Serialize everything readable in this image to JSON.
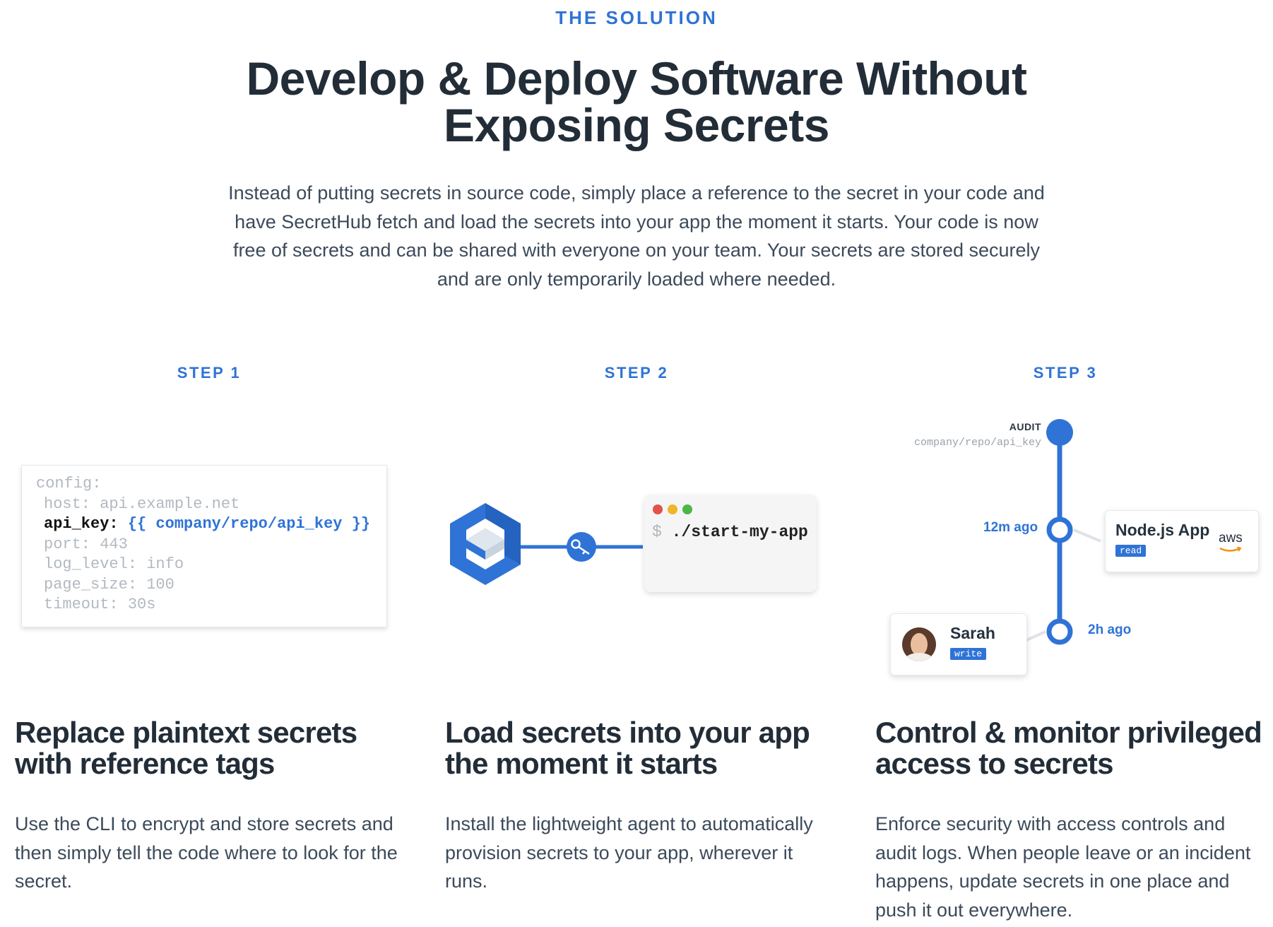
{
  "section": {
    "eyebrow": "THE SOLUTION",
    "headline_line1": "Develop & Deploy Software Without",
    "headline_line2": "Exposing Secrets",
    "intro": "Instead of putting secrets in source code, simply place a reference to the secret in your code and have SecretHub fetch and load the secrets into your app the moment it starts. Your code is now free of secrets and can be shared with everyone on your team. Your secrets are stored securely and are only temporarily loaded where needed."
  },
  "steps": [
    {
      "label": "STEP 1",
      "title": "Replace plaintext secrets with reference tags",
      "description": "Use the CLI to encrypt and store secrets and then simply tell the code where to look for the secret."
    },
    {
      "label": "STEP 2",
      "title": "Load secrets into your app the moment it starts",
      "description": "Install the lightweight agent to automatically provision secrets to your app, wherever it runs."
    },
    {
      "label": "STEP 3",
      "title": "Control & monitor privileged access to secrets",
      "description": "Enforce security with access controls and audit logs. When people leave or an incident happens, update secrets in one place and push it out everywhere."
    }
  ],
  "code_sample": {
    "line1": "config:",
    "line2": "host: api.example.net",
    "line3_key": "api_key:",
    "line3_value": "{{ company/repo/api_key }}",
    "line4": "port: 443",
    "line5": "log_level: info",
    "line6": "page_size: 100",
    "line7": "timeout: 30s"
  },
  "terminal": {
    "prompt": "$",
    "command": "./start-my-app",
    "dot_colors": [
      "#e0524b",
      "#f0b429",
      "#4bb748"
    ]
  },
  "audit": {
    "label": "AUDIT",
    "path": "company/repo/api_key",
    "event1": {
      "time": "12m ago",
      "actor": "Node.js App",
      "permission": "read",
      "provider": "aws"
    },
    "event2": {
      "time": "2h ago",
      "actor": "Sarah",
      "permission": "write"
    }
  },
  "colors": {
    "accent": "#2f73d6",
    "heading": "#222d38",
    "body": "#3c4a5a"
  },
  "icons": [
    "secrethub-logo-icon",
    "key-icon",
    "aws-logo-icon",
    "user-avatar-icon"
  ]
}
